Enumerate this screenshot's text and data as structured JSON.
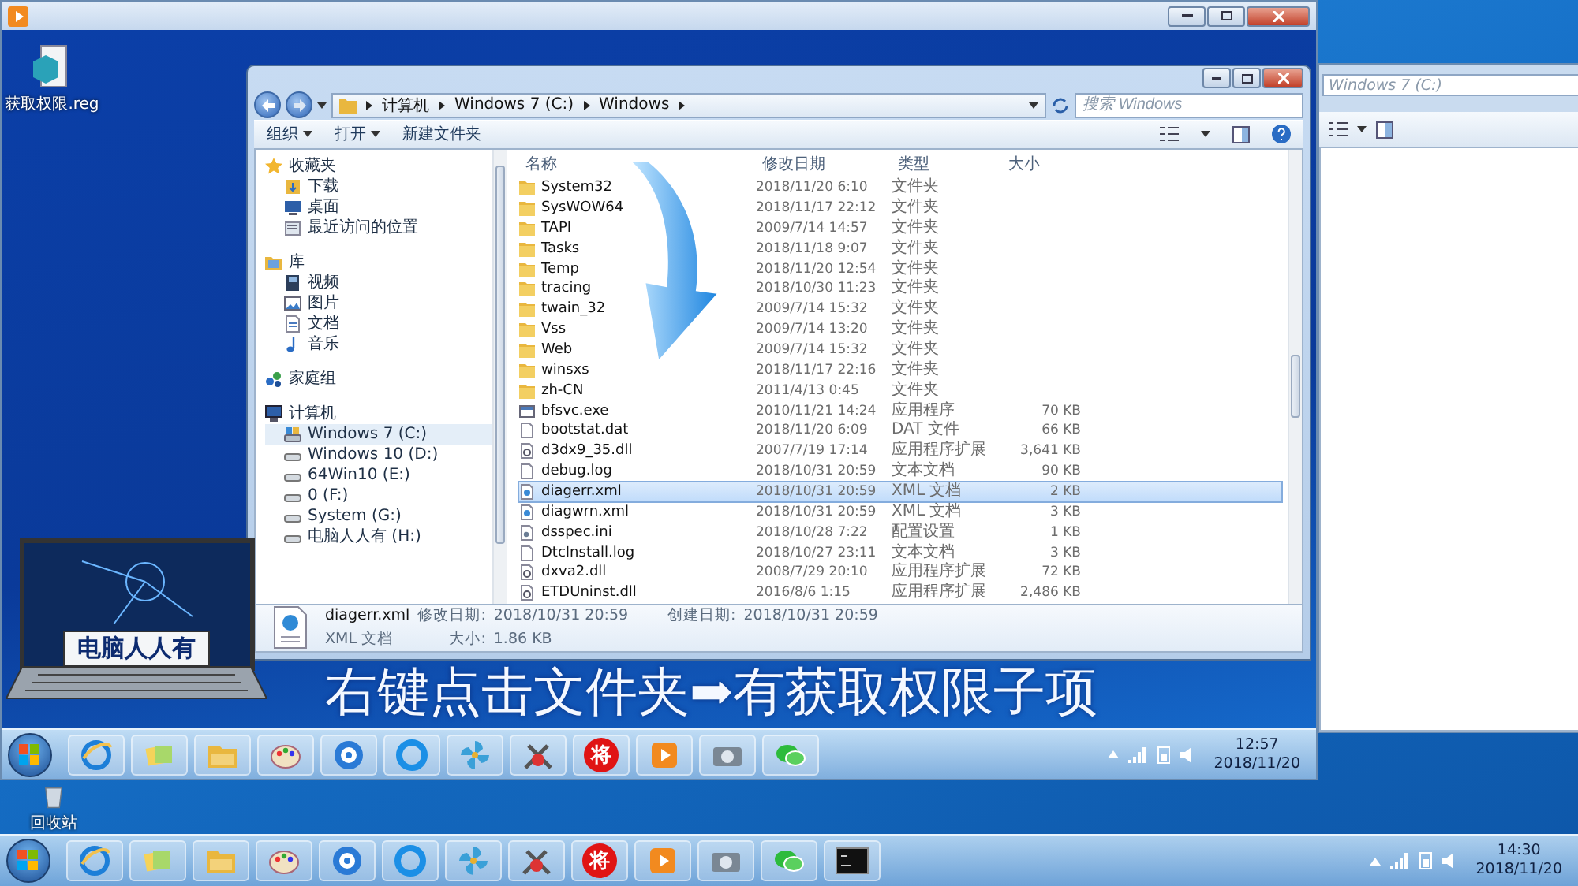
{
  "inner_desktop": {
    "icons": [
      {
        "label": "获取权限.reg"
      }
    ],
    "logo_text": "电脑人人有",
    "caption": "右键点击文件夹➡有获取权限子项"
  },
  "explorer": {
    "breadcrumb": [
      "计算机",
      "Windows 7 (C:)",
      "Windows"
    ],
    "search": {
      "placeholder": "搜索 Windows"
    },
    "toolbar": [
      {
        "label": "组织",
        "dropdown": true
      },
      {
        "label": "打开",
        "dropdown": true
      },
      {
        "label": "新建文件夹",
        "dropdown": false
      }
    ],
    "nav": [
      {
        "label": "收藏夹",
        "kind": "star",
        "selected": false,
        "children": [
          {
            "label": "下载",
            "kind": "download",
            "selected": false
          },
          {
            "label": "桌面",
            "kind": "desktop",
            "selected": false
          },
          {
            "label": "最近访问的位置",
            "kind": "recent",
            "selected": false
          }
        ]
      },
      {
        "label": "库",
        "kind": "library",
        "selected": false,
        "children": [
          {
            "label": "视频",
            "kind": "video",
            "selected": false
          },
          {
            "label": "图片",
            "kind": "picture",
            "selected": false
          },
          {
            "label": "文档",
            "kind": "document",
            "selected": false
          },
          {
            "label": "音乐",
            "kind": "music",
            "selected": false
          }
        ]
      },
      {
        "label": "家庭组",
        "kind": "homegroup",
        "selected": false
      },
      {
        "label": "计算机",
        "kind": "computer",
        "selected": false,
        "children": [
          {
            "label": "Windows 7 (C:)",
            "kind": "sysdrive",
            "selected": true
          },
          {
            "label": "Windows 10 (D:)",
            "kind": "drive",
            "selected": false
          },
          {
            "label": "64Win10 (E:)",
            "kind": "drive",
            "selected": false
          },
          {
            "label": "0 (F:)",
            "kind": "drive",
            "selected": false
          },
          {
            "label": "System (G:)",
            "kind": "drive",
            "selected": false
          },
          {
            "label": "电脑人人有 (H:)",
            "kind": "drive",
            "selected": false
          }
        ]
      }
    ],
    "columns": [
      "名称",
      "修改日期",
      "类型",
      "大小"
    ],
    "files": [
      {
        "name": "System32",
        "date": "2018/11/20 6:10",
        "type": "文件夹",
        "kind": "folder",
        "selected": false
      },
      {
        "name": "SysWOW64",
        "date": "2018/11/17 22:12",
        "type": "文件夹",
        "kind": "folder",
        "selected": false
      },
      {
        "name": "TAPI",
        "date": "2009/7/14 14:57",
        "type": "文件夹",
        "kind": "folder",
        "selected": false
      },
      {
        "name": "Tasks",
        "date": "2018/11/18 9:07",
        "type": "文件夹",
        "kind": "folder",
        "selected": false
      },
      {
        "name": "Temp",
        "date": "2018/11/20 12:54",
        "type": "文件夹",
        "kind": "folder",
        "selected": false
      },
      {
        "name": "tracing",
        "date": "2018/10/30 11:23",
        "type": "文件夹",
        "kind": "folder",
        "selected": false
      },
      {
        "name": "twain_32",
        "date": "2009/7/14 15:32",
        "type": "文件夹",
        "kind": "folder",
        "selected": false
      },
      {
        "name": "Vss",
        "date": "2009/7/14 13:20",
        "type": "文件夹",
        "kind": "folder",
        "selected": false
      },
      {
        "name": "Web",
        "date": "2009/7/14 15:32",
        "type": "文件夹",
        "kind": "folder",
        "selected": false
      },
      {
        "name": "winsxs",
        "date": "2018/11/17 22:16",
        "type": "文件夹",
        "kind": "folder",
        "selected": false
      },
      {
        "name": "zh-CN",
        "date": "2011/4/13 0:45",
        "type": "文件夹",
        "kind": "folder",
        "selected": false
      },
      {
        "name": "bfsvc.exe",
        "date": "2010/11/21 14:24",
        "type": "应用程序",
        "size": "70 KB",
        "kind": "exe",
        "selected": false
      },
      {
        "name": "bootstat.dat",
        "date": "2018/11/20 6:09",
        "type": "DAT 文件",
        "size": "66 KB",
        "kind": "file",
        "selected": false
      },
      {
        "name": "d3dx9_35.dll",
        "date": "2007/7/19 17:14",
        "type": "应用程序扩展",
        "size": "3,641 KB",
        "kind": "dll",
        "selected": false
      },
      {
        "name": "debug.log",
        "date": "2018/10/31 20:59",
        "type": "文本文档",
        "size": "90 KB",
        "kind": "file",
        "selected": false
      },
      {
        "name": "diagerr.xml",
        "date": "2018/10/31 20:59",
        "type": "XML 文档",
        "size": "2 KB",
        "kind": "xml",
        "selected": true
      },
      {
        "name": "diagwrn.xml",
        "date": "2018/10/31 20:59",
        "type": "XML 文档",
        "size": "3 KB",
        "kind": "xml",
        "selected": false
      },
      {
        "name": "dsspec.ini",
        "date": "2018/10/28 7:22",
        "type": "配置设置",
        "size": "1 KB",
        "kind": "ini",
        "selected": false
      },
      {
        "name": "DtcInstall.log",
        "date": "2018/10/27 23:11",
        "type": "文本文档",
        "size": "3 KB",
        "kind": "file",
        "selected": false
      },
      {
        "name": "dxva2.dll",
        "date": "2008/7/29 20:10",
        "type": "应用程序扩展",
        "size": "72 KB",
        "kind": "dll",
        "selected": false
      },
      {
        "name": "ETDUninst.dll",
        "date": "2016/8/6 1:15",
        "type": "应用程序扩展",
        "size": "2,486 KB",
        "kind": "dll",
        "selected": false
      }
    ],
    "details": {
      "name": "diagerr.xml",
      "type": "XML 文档",
      "modified_label": "修改日期:",
      "modified": "2018/10/31 20:59",
      "created_label": "创建日期:",
      "created": "2018/10/31 20:59",
      "size_label": "大小:",
      "size": "1.86 KB"
    }
  },
  "inner_taskbar": {
    "apps": [
      {
        "kind": "ie"
      },
      {
        "kind": "folders"
      },
      {
        "kind": "explorer"
      },
      {
        "kind": "paint"
      },
      {
        "kind": "media"
      },
      {
        "kind": "browser"
      },
      {
        "kind": "pinwheel"
      },
      {
        "kind": "tools"
      },
      {
        "kind": "chess",
        "label": "将"
      },
      {
        "kind": "player"
      },
      {
        "kind": "camera"
      },
      {
        "kind": "wechat"
      }
    ],
    "time": "12:57",
    "date": "2018/11/20"
  },
  "side_window": {
    "search": {
      "placeholder": "Windows 7 (C:)"
    }
  },
  "desktop_icons": [
    {
      "label": "回收站"
    }
  ],
  "taskbar": {
    "apps": [
      {
        "kind": "ie"
      },
      {
        "kind": "folders"
      },
      {
        "kind": "explorer"
      },
      {
        "kind": "paint"
      },
      {
        "kind": "media"
      },
      {
        "kind": "browser"
      },
      {
        "kind": "pinwheel"
      },
      {
        "kind": "tools"
      },
      {
        "kind": "chess",
        "label": "将"
      },
      {
        "kind": "player"
      },
      {
        "kind": "camera"
      },
      {
        "kind": "wechat"
      },
      {
        "kind": "cmd"
      }
    ],
    "time": "14:30",
    "date": "2018/11/20"
  }
}
